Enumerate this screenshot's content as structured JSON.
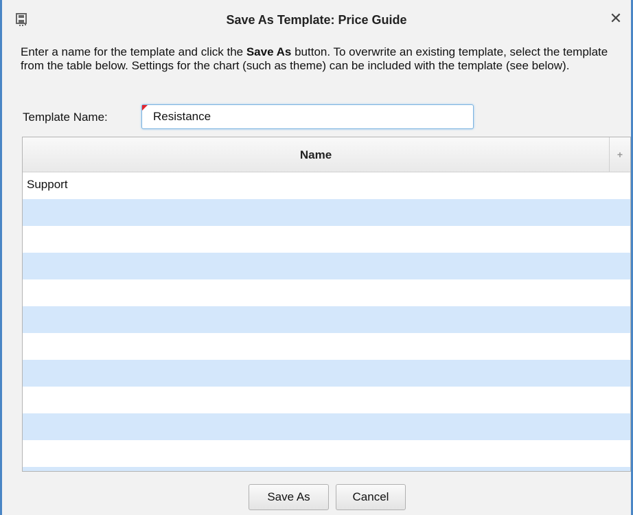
{
  "dialog": {
    "title": "Save As Template: Price Guide",
    "close_symbol": "✕",
    "icon": "save-icon"
  },
  "instructions": {
    "part1": "Enter a name for the template and click the ",
    "bold": "Save As",
    "part2": " button.  To overwrite an existing template, select the template from the table below.  Settings for the chart (such as theme) can be included with the template (see below)."
  },
  "template_name": {
    "label": "Template Name:",
    "value": "Resistance"
  },
  "table": {
    "column_header": "Name",
    "add_column_symbol": "+",
    "rows": [
      "Support",
      "",
      "",
      "",
      "",
      "",
      "",
      "",
      "",
      "",
      "",
      "",
      ""
    ]
  },
  "buttons": {
    "save_as": "Save As",
    "cancel": "Cancel"
  }
}
